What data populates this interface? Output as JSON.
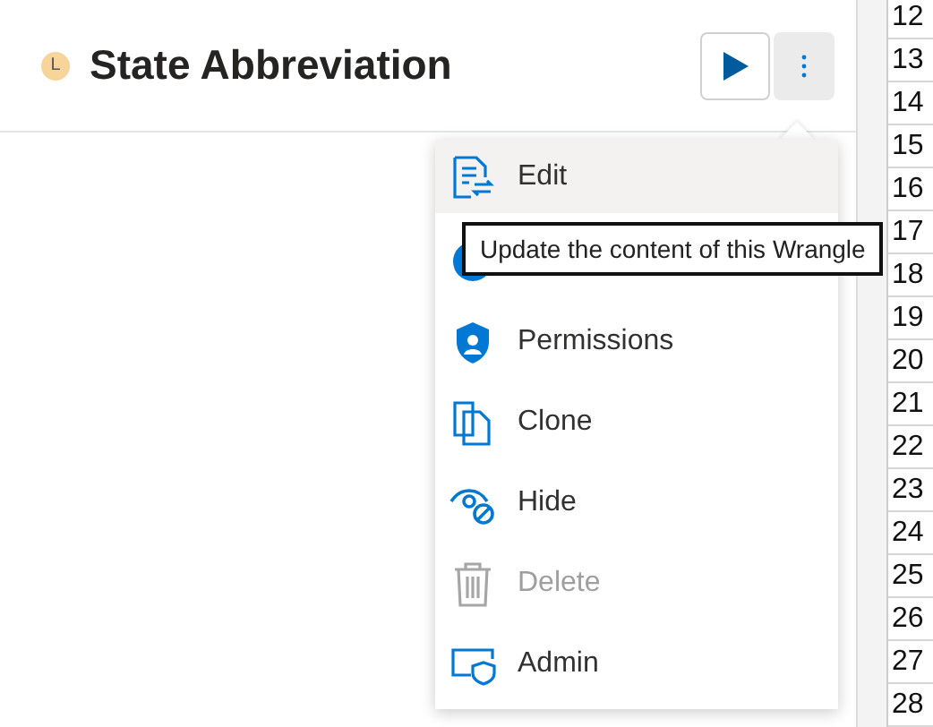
{
  "header": {
    "badge": "L",
    "title": "State Abbreviation"
  },
  "actions": [
    {
      "kind": "play"
    },
    {
      "kind": "more",
      "selected": true
    }
  ],
  "menu": [
    {
      "kind": "edit",
      "label": "Edit",
      "hovered": true,
      "disabled": false
    },
    {
      "kind": "circle",
      "hovered": false,
      "disabled": false
    },
    {
      "kind": "lock",
      "label": "Permissions",
      "hovered": false,
      "disabled": false
    },
    {
      "kind": "clone",
      "label": "Clone",
      "hovered": false,
      "disabled": false
    },
    {
      "kind": "hide",
      "label": "Hide",
      "hovered": false,
      "disabled": false
    },
    {
      "kind": "trash",
      "label": "Delete",
      "hovered": false,
      "disabled": true
    },
    {
      "kind": "admin",
      "label": "Admin",
      "hovered": false,
      "disabled": false
    }
  ],
  "tooltip": "Update the content of this Wrangle",
  "row_numbers": [
    "12",
    "13",
    "14",
    "15",
    "16",
    "17",
    "18",
    "19",
    "20",
    "21",
    "22",
    "23",
    "24",
    "25",
    "26",
    "27",
    "28"
  ]
}
